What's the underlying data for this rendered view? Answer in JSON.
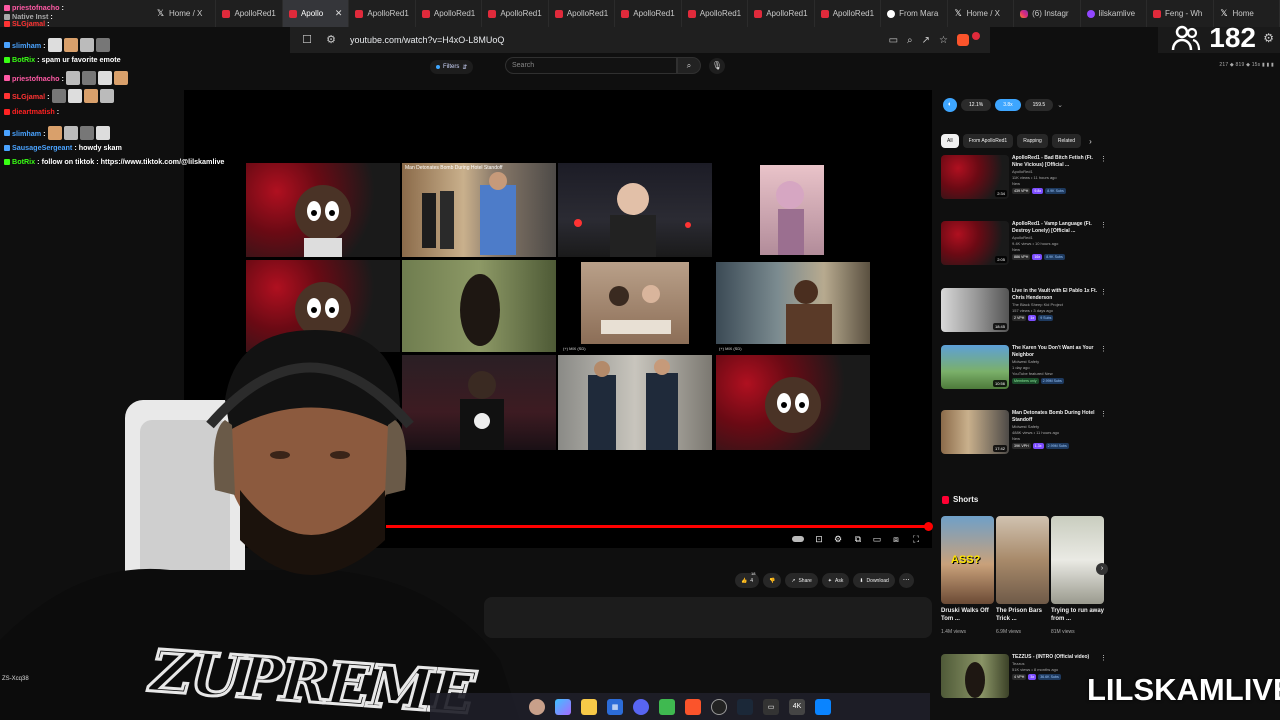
{
  "browser": {
    "tabs": [
      {
        "label": "Home / X",
        "icon": "x-logo",
        "active": false
      },
      {
        "label": "ApolloRed1",
        "icon": "youtube",
        "active": false
      },
      {
        "label": "Apollo",
        "icon": "youtube",
        "active": true,
        "close": "✕"
      },
      {
        "label": "ApolloRed1",
        "icon": "youtube",
        "active": false
      },
      {
        "label": "ApolloRed1",
        "icon": "youtube",
        "active": false
      },
      {
        "label": "ApolloRed1",
        "icon": "youtube",
        "active": false
      },
      {
        "label": "ApolloRed1",
        "icon": "youtube",
        "active": false
      },
      {
        "label": "ApolloRed1",
        "icon": "youtube",
        "active": false
      },
      {
        "label": "ApolloRed1",
        "icon": "youtube",
        "active": false
      },
      {
        "label": "ApolloRed1",
        "icon": "youtube",
        "active": false
      },
      {
        "label": "ApolloRed1",
        "icon": "youtube",
        "active": false
      },
      {
        "label": "From Mara",
        "icon": "ai",
        "active": false
      },
      {
        "label": "Home / X",
        "icon": "x-logo",
        "active": false
      },
      {
        "label": "(6) Instagr",
        "icon": "instagram",
        "active": false
      },
      {
        "label": "lilskamlive",
        "icon": "twitch",
        "active": false
      },
      {
        "label": "Feng - Wh",
        "icon": "youtube",
        "active": false
      },
      {
        "label": "Home",
        "icon": "x-logo",
        "active": false
      }
    ],
    "url": "youtube.com/watch?v=H4xO-L8MUoQ"
  },
  "viewers": {
    "count": "182"
  },
  "youtube": {
    "filters_label": "Filters",
    "search_placeholder": "Search",
    "right_info": "217 ◆ 819 ◆ 15s ▮ ▮ ▮",
    "progress_fraction": 1.0,
    "actions": {
      "like_count": "18",
      "like_suffix": "4",
      "share": "Share",
      "ask": "Ask",
      "download": "Download"
    },
    "video_cells": [
      {
        "title": "",
        "bottom": ""
      },
      {
        "title": "Man Detonates Bomb During Hotel Standoff",
        "bottom": ""
      },
      {
        "title": "",
        "bottom": ""
      },
      {
        "title": "",
        "bottom": ""
      },
      {
        "title": "",
        "bottom": "(+) MIX (SD)"
      },
      {
        "title": "",
        "bottom": "(+) MIX (SD)"
      }
    ],
    "miniplayer": {
      "pill1": "12.1%",
      "pill2": "3.8x",
      "pill3": "159.5"
    },
    "chips": [
      "All",
      "From ApolloRed1",
      "Rapping",
      "Related"
    ],
    "recommendations": [
      {
        "title": "ApolloRed1 - Bad Bitch Fetish (Ft. Nine Vicious) [Official ...",
        "channel": "ApolloRed1",
        "meta": "11K views • 11 hours ago",
        "tag": "New",
        "duration": "2:34",
        "badges": [
          "439 VPH",
          "9.8x",
          "8.9K Subs"
        ]
      },
      {
        "title": "ApolloRed1 - Vamp Language (Ft. Destroy Lonely) [Official ...",
        "channel": "ApolloRed1",
        "meta": "9.4K views • 10 hours ago",
        "tag": "New",
        "duration": "2:05",
        "badges": [
          "886 VPH",
          "16x",
          "8.9K Subs"
        ]
      },
      {
        "title": "Live in the Vault with El Pablo 1x Ft. Chris Henderson",
        "channel": "The Black Sheep Kid Project",
        "meta": "157 views • 3 days ago",
        "tag": "",
        "duration": "18:45",
        "badges": [
          "2 VPH",
          "1x",
          "9 Subs"
        ]
      },
      {
        "title": "The Karen You Don't Want as Your Neighbor",
        "channel": "Midwest Safety",
        "meta": "1 day ago",
        "tag": "YouTube featured  New",
        "duration": "10:56",
        "badges": [
          "Members only",
          "2.99M Subs"
        ]
      },
      {
        "title": "Man Detonates Bomb During Hotel Standoff",
        "channel": "Midwest Safety",
        "meta": "488K views • 11 hours ago",
        "tag": "New",
        "duration": "17:42",
        "badges": [
          "39K VPH",
          "1.3x",
          "2.99M Subs"
        ]
      }
    ],
    "shorts_heading": "Shorts",
    "shorts": [
      {
        "title": "Druski Walks Off Tom ...",
        "views": "1.4M views",
        "overlay": "ASS?"
      },
      {
        "title": "The Prison Bars Trick ...",
        "views": "6.9M views",
        "overlay": ""
      },
      {
        "title": "Trying to run away from ...",
        "views": "81M views",
        "overlay": ""
      }
    ],
    "bottom_rec": {
      "title": "TEZZUS - (INTRO (Official video)",
      "channel": "Tezzus",
      "meta": "51K views • 8 months ago",
      "badges": [
        "4 VPH",
        "3x",
        "36.6K Subs"
      ]
    }
  },
  "chat": [
    {
      "user": "priestofnacho",
      "color": "#ff5aa5",
      "msg": ""
    },
    {
      "user": "Native Inst",
      "color": "#aaaaaa",
      "msg": ""
    },
    {
      "user": "SLGjamal",
      "color": "#ff3333",
      "msg": ""
    },
    {
      "user": "slimham",
      "color": "#4aa3ff",
      "msg": ""
    },
    {
      "user": "BotRix",
      "color": "#39ff14",
      "msg": "spam ur favorite emote"
    },
    {
      "user": "priestofnacho",
      "color": "#ff5aa5",
      "msg": ""
    },
    {
      "user": "SLGjamal",
      "color": "#ff3333",
      "msg": ""
    },
    {
      "user": "dieartmatish",
      "color": "#ff2222",
      "msg": ""
    },
    {
      "user": "slimham",
      "color": "#4aa3ff",
      "msg": ""
    },
    {
      "user": "SausageSergeant",
      "color": "#4aa3ff",
      "msg": "howdy skam"
    },
    {
      "user": "BotRix",
      "color": "#39ff14",
      "msg": "follow on tiktok : https://www.tiktok.com/@lilskamlive"
    }
  ],
  "webcam": {
    "shirt_text": "ZUPREME",
    "cam_label": "ZS-Xcq38"
  },
  "brand": "LILSKAMLIVE"
}
